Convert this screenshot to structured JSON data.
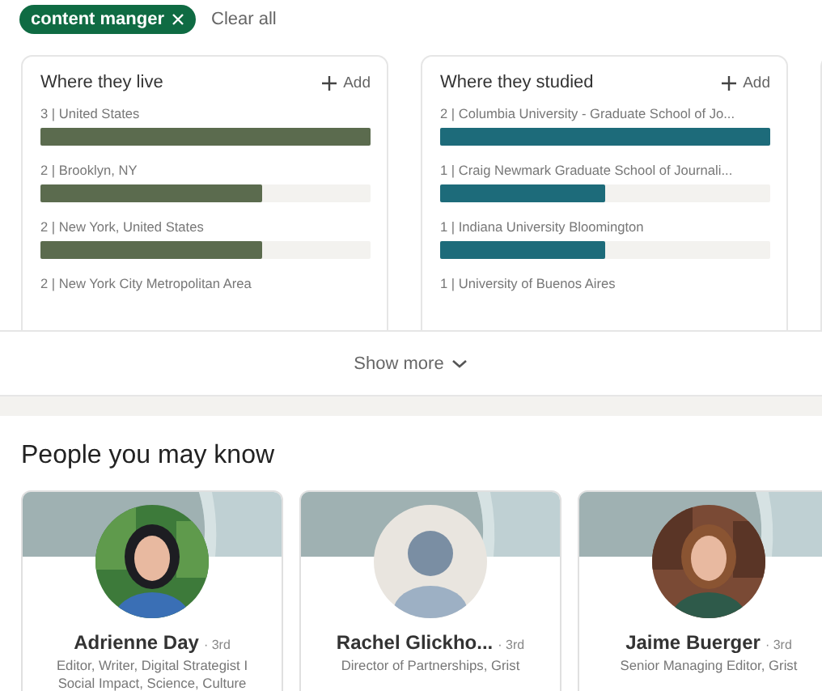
{
  "filter": {
    "label": "content manger"
  },
  "clear_all": "Clear all",
  "panels": [
    {
      "title": "Where they live",
      "add": "Add",
      "color": "#5b6b4e",
      "items": [
        {
          "label": "3 | United States",
          "level": 1
        },
        {
          "label": "2 | Brooklyn, NY",
          "level": 0.67
        },
        {
          "label": "2 | New York, United States",
          "level": 0.67
        },
        {
          "label": "2 | New York City Metropolitan Area"
        }
      ]
    },
    {
      "title": "Where they studied",
      "add": "Add",
      "color": "#1d6b7a",
      "items": [
        {
          "label": "2 | Columbia University - Graduate School of Jo...",
          "level": 1
        },
        {
          "label": "1 | Craig Newmark Graduate School of Journali...",
          "level": 0.5
        },
        {
          "label": "1 | Indiana University Bloomington",
          "level": 0.5
        },
        {
          "label": "1 | University of Buenos Aires"
        }
      ]
    }
  ],
  "show_more": "Show more",
  "people_title": "People you may know",
  "people": [
    {
      "name": "Adrienne Day",
      "degree": "· 3rd",
      "headline": "Editor, Writer, Digital Strategist I Social Impact, Science, Culture"
    },
    {
      "kind": "placeholder",
      "name": "Rachel Glickho...",
      "degree": "· 3rd",
      "headline": "Director of Partnerships, Grist"
    },
    {
      "name": "Jaime Buerger",
      "degree": "· 3rd",
      "headline": "Senior Managing Editor, Grist"
    }
  ]
}
